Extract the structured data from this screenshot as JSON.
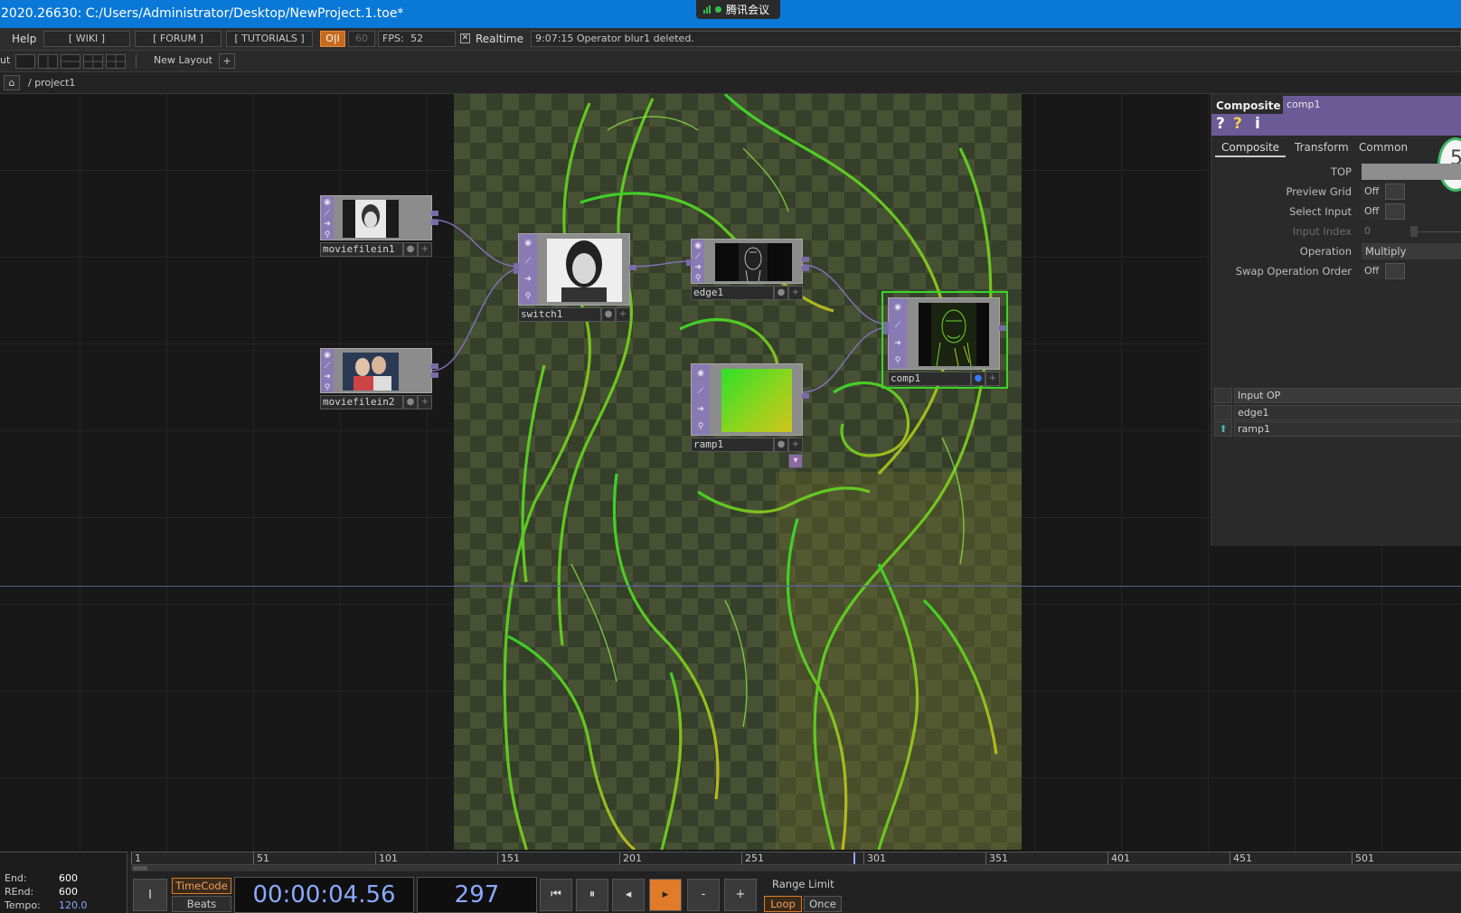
{
  "titlebar": {
    "title": "2020.26630: C:/Users/Administrator/Desktop/NewProject.1.toe*"
  },
  "meeting": {
    "label": "腾讯会议"
  },
  "menubar": {
    "help": "Help",
    "wiki": "[ WIKI ]",
    "forum": "[ FORUM ]",
    "tutorials": "[ TUTORIALS ]",
    "oi": "O|I",
    "fps_limit": "60",
    "fps_label": "FPS:",
    "fps_value": "52",
    "realtime_label": "Realtime",
    "realtime_checked": "true",
    "status": "9:07:15 Operator blur1 deleted."
  },
  "layoutbar": {
    "prefix": "ut",
    "new_layout": "New Layout",
    "add": "+"
  },
  "pathbar": {
    "path": "/ project1"
  },
  "network": {
    "nodes": [
      {
        "name": "moviefilein1"
      },
      {
        "name": "moviefilein2"
      },
      {
        "name": "switch1"
      },
      {
        "name": "edge1"
      },
      {
        "name": "ramp1"
      },
      {
        "name": "comp1"
      }
    ]
  },
  "params": {
    "op_type": "Composite",
    "op_name": "comp1",
    "help_icons": [
      "?",
      "?",
      "i"
    ],
    "badge": "5",
    "tabs": [
      "Composite",
      "Transform",
      "Common"
    ],
    "active_tab": "Composite",
    "rows": [
      {
        "label": "TOP",
        "value": ""
      },
      {
        "label": "Preview Grid",
        "value": "Off"
      },
      {
        "label": "Select Input",
        "value": "Off"
      },
      {
        "label": "Input Index",
        "value": "0"
      },
      {
        "label": "Operation",
        "value": "Multiply"
      },
      {
        "label": "Swap Operation Order",
        "value": "Off"
      }
    ],
    "inputs_header": "Input OP",
    "inputs": [
      "edge1",
      "ramp1"
    ]
  },
  "timeline": {
    "end_label": "End:",
    "end_value": "600",
    "rend_label": "REnd:",
    "rend_value": "600",
    "tempo_label": "Tempo:",
    "tempo_value": "120.0",
    "ruler_ticks": [
      "1",
      "51",
      "101",
      "151",
      "201",
      "251",
      "301",
      "351",
      "401",
      "451",
      "501"
    ],
    "current_frame_marker": 297,
    "timecode_label": "TimeCode",
    "beats_label": "Beats",
    "timecode": "00:00:04.56",
    "frame": "297",
    "range_limit": "Range Limit",
    "loop": "Loop",
    "once": "Once",
    "controls": [
      "⏮",
      "⏸",
      "◂",
      "▸",
      "-",
      "+"
    ],
    "colors": {
      "accent": "#e07b2a",
      "timecode_text": "#8aaaff"
    }
  }
}
